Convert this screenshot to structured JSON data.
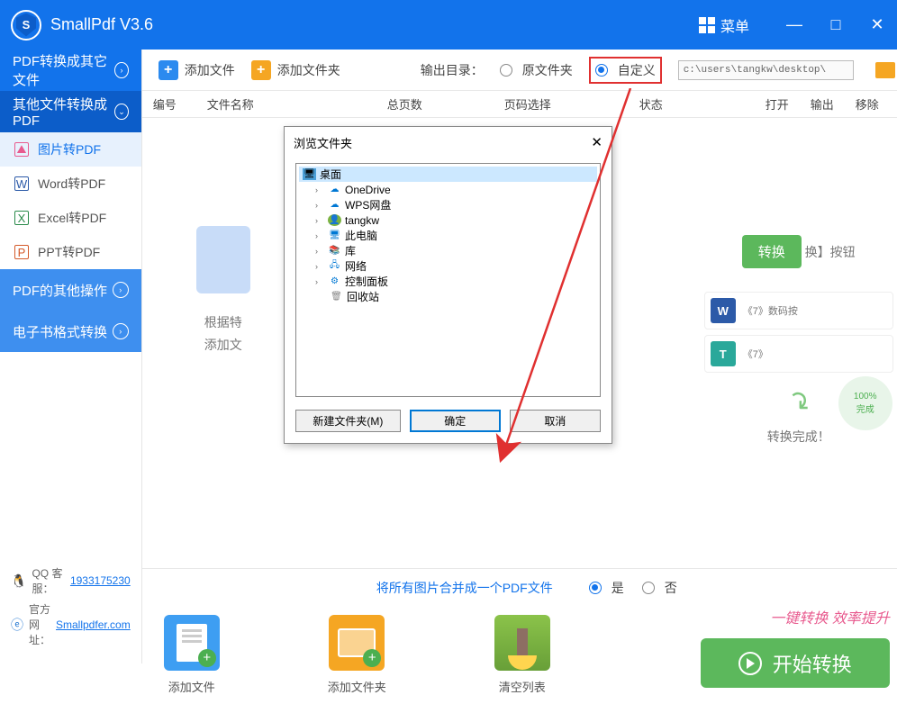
{
  "app": {
    "title": "SmallPdf V3.6",
    "menu": "菜单"
  },
  "sidebar": {
    "sections": [
      {
        "label": "PDF转换成其它文件"
      },
      {
        "label": "其他文件转换成PDF"
      },
      {
        "label": "PDF的其他操作"
      },
      {
        "label": "电子书格式转换"
      }
    ],
    "items": [
      {
        "label": "图片转PDF"
      },
      {
        "label": "Word转PDF"
      },
      {
        "label": "Excel转PDF"
      },
      {
        "label": "PPT转PDF"
      }
    ],
    "qq_label": "QQ 客服：",
    "qq_number": "1933175230",
    "site_label": "官方网址：",
    "site_url": "Smallpdfer.com"
  },
  "toolbar": {
    "add_file": "添加文件",
    "add_folder": "添加文件夹",
    "output_label": "输出目录：",
    "radio_source": "原文件夹",
    "radio_custom": "自定义",
    "path": "c:\\users\\tangkw\\desktop\\"
  },
  "columns": {
    "c1": "编号",
    "c2": "文件名称",
    "c3": "总页数",
    "c4": "页码选择",
    "c5": "状态",
    "c6": "打开",
    "c7": "输出",
    "c8": "移除"
  },
  "bg": {
    "line1": "根据特",
    "line2": "添加文",
    "convert_btn": "转换",
    "after_btn": "换】按钮",
    "file1": "《7》数码按",
    "file2": "《7》",
    "progress": "100%",
    "progress_label": "完成",
    "done": "转换完成！"
  },
  "merge": {
    "label": "将所有图片合并成一个PDF文件",
    "yes": "是",
    "no": "否"
  },
  "bottom": {
    "add_file": "添加文件",
    "add_folder": "添加文件夹",
    "clear": "清空列表",
    "slogan": "一键转换  效率提升",
    "start": "开始转换"
  },
  "dialog": {
    "title": "浏览文件夹",
    "tree": {
      "root": "桌面",
      "items": [
        "OneDrive",
        "WPS网盘",
        "tangkw",
        "此电脑",
        "库",
        "网络",
        "控制面板",
        "回收站"
      ]
    },
    "new_folder": "新建文件夹(M)",
    "ok": "确定",
    "cancel": "取消"
  }
}
